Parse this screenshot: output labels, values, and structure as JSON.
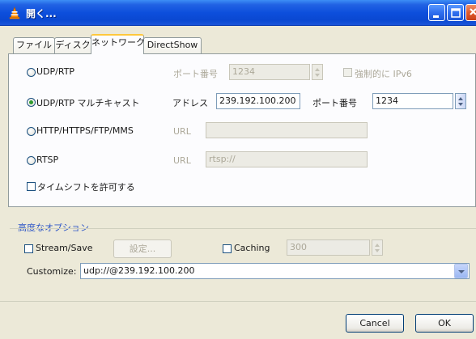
{
  "window": {
    "title": "開く...",
    "accent": "#0a48d2",
    "controls": [
      "minimize-icon",
      "maximize-icon",
      "close-icon"
    ]
  },
  "tabs": [
    {
      "label": "ファイル",
      "active": false
    },
    {
      "label": "ディスク",
      "active": false
    },
    {
      "label": "ネットワーク",
      "active": true
    },
    {
      "label": "DirectShow",
      "active": false
    }
  ],
  "network": {
    "udp": {
      "label": "UDP/RTP",
      "port_label": "ポート番号",
      "port_value": "1234",
      "ipv6_label": "強制的に IPv6"
    },
    "multicast": {
      "label": "UDP/RTP マルチキャスト",
      "address_label": "アドレス",
      "address_value": "239.192.100.200",
      "port_label": "ポート番号",
      "port_value": "1234"
    },
    "http": {
      "label": "HTTP/HTTPS/FTP/MMS",
      "url_label": "URL",
      "url_value": ""
    },
    "rtsp": {
      "label": "RTSP",
      "url_label": "URL",
      "url_value": "rtsp://"
    },
    "timeshift_label": "タイムシフトを許可する"
  },
  "advanced": {
    "title": "高度なオプション",
    "title_color": "#2f57c7",
    "stream_label": "Stream/Save",
    "settings_label": "設定...",
    "caching_label": "Caching",
    "caching_value": "300",
    "customize_label": "Customize:",
    "customize_value": "udp://@239.192.100.200"
  },
  "buttons": {
    "cancel": "Cancel",
    "ok": "OK"
  }
}
